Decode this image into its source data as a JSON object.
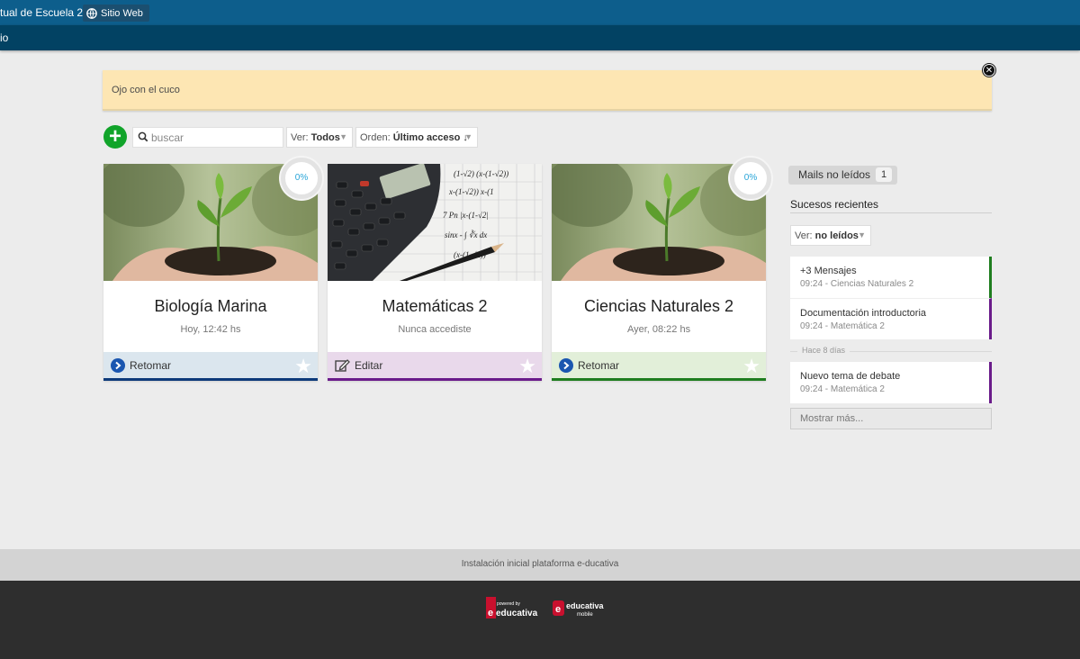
{
  "topbar": {
    "site_name": "tual de Escuela 2.0",
    "web_button": "Sitio Web"
  },
  "navbar": {
    "text": "io"
  },
  "alert": {
    "text": "Ojo con el cuco"
  },
  "toolbar": {
    "search_placeholder": "buscar",
    "view_label": "Ver:",
    "view_value": "Todos",
    "order_label": "Orden:",
    "order_value": "Último acceso ↓"
  },
  "courses": [
    {
      "title": "Biología Marina",
      "subtitle": "Hoy, 12:42 hs",
      "action": "Retomar",
      "progress": "0%",
      "accent": "#0d3a7a",
      "footer_bg": "#dbe6ee"
    },
    {
      "title": "Matemáticas 2",
      "subtitle": "Nunca accediste",
      "action": "Editar",
      "accent": "#6a1b8a",
      "footer_bg": "#e9d9eb"
    },
    {
      "title": "Ciencias Naturales 2",
      "subtitle": "Ayer, 08:22 hs",
      "action": "Retomar",
      "progress": "0%",
      "accent": "#1f7d1f",
      "footer_bg": "#e2efd9"
    }
  ],
  "sidebar": {
    "mails_label": "Mails no leídos",
    "mails_count": "1",
    "events_title": "Sucesos recientes",
    "filter_label": "Ver:",
    "filter_value": "no leídos",
    "events": [
      {
        "title": "+3 Mensajes",
        "sub": "09:24 - Ciencias Naturales 2",
        "color": "#1f7d1f"
      },
      {
        "title": "Documentación introductoria",
        "sub": "09:24 - Matemática 2",
        "color": "#6a1b8a"
      },
      {
        "title": "Nuevo tema de debate",
        "sub": "09:24 - Matemática 2",
        "color": "#6a1b8a"
      }
    ],
    "separator": "Hace 8 días",
    "more_button": "Mostrar más..."
  },
  "footer": {
    "text": "Instalación inicial plataforma e-ducativa",
    "logo1_small": "powered by",
    "logo1_text": "educativa",
    "logo2_text": "educativa",
    "logo2_small": "mobile"
  }
}
